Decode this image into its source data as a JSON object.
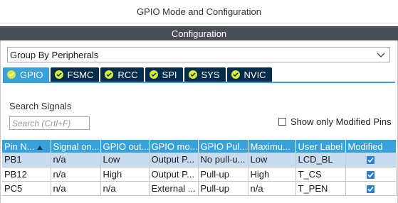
{
  "window": {
    "title": "GPIO Mode and Configuration"
  },
  "config_header": "Configuration",
  "group_by": {
    "value": "Group By Peripherals"
  },
  "tabs": [
    {
      "label": "GPIO",
      "active": true
    },
    {
      "label": "FSMC",
      "active": false
    },
    {
      "label": "RCC",
      "active": false
    },
    {
      "label": "SPI",
      "active": false
    },
    {
      "label": "SYS",
      "active": false
    },
    {
      "label": "NVIC",
      "active": false
    }
  ],
  "search": {
    "label": "Search Signals",
    "placeholder": "Search (Crtl+F)",
    "value": ""
  },
  "show_modified": {
    "label": "Show only Modified Pins",
    "checked": false
  },
  "table": {
    "columns": [
      "Pin N...",
      "Signal on...",
      "GPIO out...",
      "GPIO mo...",
      "GPIO Pul...",
      "Maximu...",
      "User Label",
      "Modified"
    ],
    "rows": [
      {
        "pin": "PB1",
        "signal": "n/a",
        "output": "Low",
        "mode": "Output P...",
        "pull": "No pull-u...",
        "speed": "Low",
        "label": "LCD_BL",
        "modified": true,
        "selected": true
      },
      {
        "pin": "PB12",
        "signal": "n/a",
        "output": "High",
        "mode": "Output P...",
        "pull": "Pull-up",
        "speed": "High",
        "label": "T_CS",
        "modified": true,
        "selected": false
      },
      {
        "pin": "PC5",
        "signal": "n/a",
        "output": "n/a",
        "mode": "External ...",
        "pull": "Pull-up",
        "speed": "n/a",
        "label": "T_PEN",
        "modified": true,
        "selected": false
      }
    ]
  },
  "colors": {
    "tab_dark": "#032d4a",
    "tab_active": "#3aa0d9",
    "config_band": "#4a4f57",
    "check_badge": "#d9e93a",
    "selected_row": "#c8dcf0"
  }
}
